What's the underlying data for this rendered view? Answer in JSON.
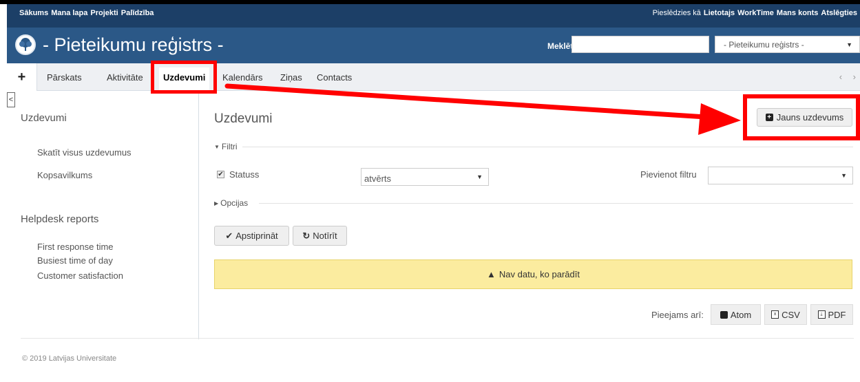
{
  "topmenu": {
    "left_items": [
      "Sākums",
      "Mana lapa",
      "Projekti",
      "Palīdzība"
    ],
    "logged_in_prefix": "Pieslēdzies kā",
    "user_name": "Lietotajs",
    "right_items": [
      "WorkTime",
      "Mans konts",
      "Atslēgties"
    ]
  },
  "header": {
    "title": "- Pieteikumu reģistrs -",
    "search_label": "Meklēt:",
    "search_value": "",
    "project_select": "- Pieteikumu reģistrs -"
  },
  "tabs": {
    "new_label": "+",
    "items": [
      {
        "label": "Pārskats"
      },
      {
        "label": "Aktivitāte"
      },
      {
        "label": "Uzdevumi"
      },
      {
        "label": "Kalendārs"
      },
      {
        "label": "Ziņas"
      },
      {
        "label": "Contacts"
      }
    ],
    "active_index": 2,
    "scroll_label": "‹ ›"
  },
  "sidebar": {
    "toggle_label": "<",
    "issues_heading": "Uzdevumi",
    "issues_links": [
      "Skatīt visus uzdevumus",
      "Kopsavilkums"
    ],
    "reports_heading": "Helpdesk reports",
    "reports_links": [
      "First response time",
      "Busiest time of day",
      "Customer satisfaction"
    ]
  },
  "main": {
    "title": "Uzdevumi",
    "new_issue_label": "Jauns uzdevums",
    "filters_legend": "Filtri",
    "status_label": "Statuss",
    "status_checked": true,
    "status_value": "atvērts",
    "add_filter_label": "Pievienot filtru",
    "add_filter_value": "",
    "options_legend": "Opcijas",
    "apply_label": "Apstiprināt",
    "clear_label": "Notīrīt",
    "nodata_text": "Nav datu, ko parādīt",
    "also_label": "Pieejams arī:",
    "formats": [
      "Atom",
      "CSV",
      "PDF"
    ]
  },
  "footer": {
    "text": "© 2019 Latvijas Universitate"
  },
  "colors": {
    "topmenu_bg": "#1c3f67",
    "header_bg": "#2b5887",
    "annotation": "#ff0000",
    "nodata_bg": "#fbec9f"
  },
  "icons": {
    "logo": "university-tree-logo",
    "new_issue": "plus-square-icon",
    "apply": "check-icon",
    "clear": "reload-icon",
    "nodata": "warning-triangle-icon",
    "atom": "rss-icon",
    "csv": "spreadsheet-file-icon",
    "pdf": "pdf-file-icon"
  }
}
